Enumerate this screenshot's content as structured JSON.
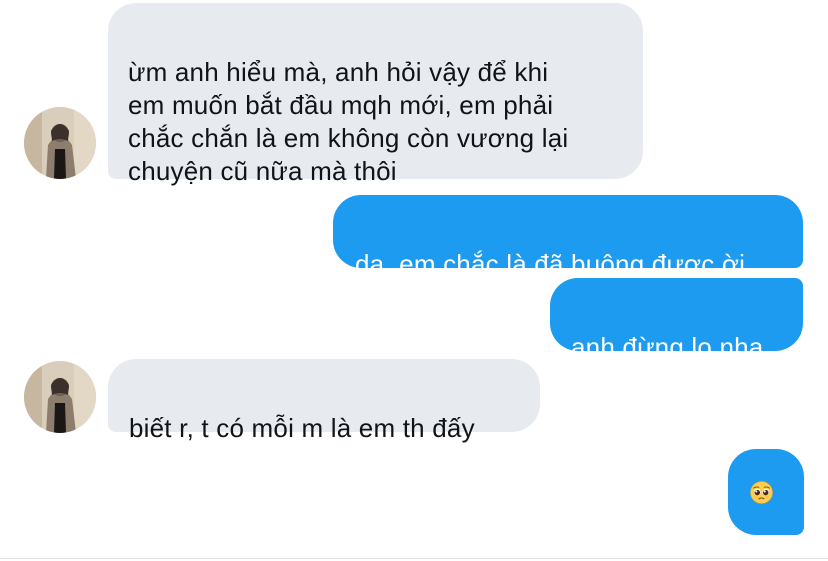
{
  "conversation": {
    "messages": [
      {
        "sender": "contact",
        "text": "ừm anh hiểu mà, anh hỏi vậy để khi\nem muốn bắt đầu mqh mới, em phải\nchắc chắn là em không còn vương lại\nchuyện cũ nữa mà thôi"
      },
      {
        "sender": "me",
        "text": "dạ, em chắc là đã buông được ời"
      },
      {
        "sender": "me",
        "text": "anh đừng lo nha"
      },
      {
        "sender": "contact",
        "text": "biết r, t có mỗi m là em th đấy"
      },
      {
        "sender": "me",
        "emoji": "pleading-face-emoji"
      }
    ]
  },
  "colors": {
    "incoming_bubble": "#e7ebef",
    "outgoing_bubble": "#1d9bf0",
    "incoming_text": "#0f1419",
    "outgoing_text": "#ffffff"
  }
}
